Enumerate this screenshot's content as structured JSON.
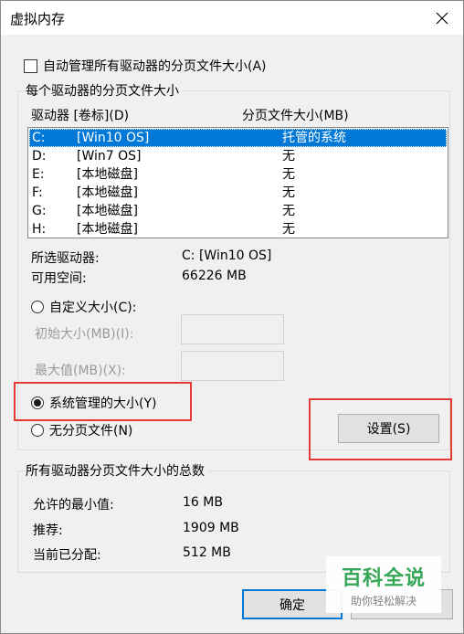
{
  "window": {
    "title": "虚拟内存"
  },
  "auto_manage": {
    "label": "自动管理所有驱动器的分页文件大小(A)",
    "checked": false
  },
  "per_drive": {
    "group_label": "每个驱动器的分页文件大小",
    "columns": [
      "驱动器 [卷标](D)",
      "分页文件大小(MB)"
    ],
    "rows": [
      {
        "drive": "C:",
        "label": "[Win10 OS]",
        "size": "托管的系统",
        "selected": true
      },
      {
        "drive": "D:",
        "label": "[Win7 OS]",
        "size": "无",
        "selected": false
      },
      {
        "drive": "E:",
        "label": "[本地磁盘]",
        "size": "无",
        "selected": false
      },
      {
        "drive": "F:",
        "label": "[本地磁盘]",
        "size": "无",
        "selected": false
      },
      {
        "drive": "G:",
        "label": "[本地磁盘]",
        "size": "无",
        "selected": false
      },
      {
        "drive": "H:",
        "label": "[本地磁盘]",
        "size": "无",
        "selected": false
      }
    ],
    "selected_drive_label": "所选驱动器:",
    "selected_drive_value": "C:  [Win10 OS]",
    "free_space_label": "可用空间:",
    "free_space_value": "66226 MB",
    "custom_size_label": "自定义大小(C):",
    "initial_size_label": "初始大小(MB)(I):",
    "max_size_label": "最大值(MB)(X):",
    "system_managed_label": "系统管理的大小(Y)",
    "no_paging_label": "无分页文件(N)",
    "set_button": "设置(S)",
    "selected_option": "system_managed"
  },
  "totals": {
    "group_label": "所有驱动器分页文件大小的总数",
    "min_allowed_label": "允许的最小值:",
    "min_allowed_value": "16 MB",
    "recommended_label": "推荐:",
    "recommended_value": "1909 MB",
    "current_label": "当前已分配:",
    "current_value": "512 MB"
  },
  "footer": {
    "ok_button": "确定"
  },
  "watermark": {
    "main": "百科全说",
    "sub": "助你轻松解决"
  },
  "colors": {
    "selection": "#0078d7",
    "highlight": "#e53935",
    "watermark_green": "#2da44e"
  }
}
